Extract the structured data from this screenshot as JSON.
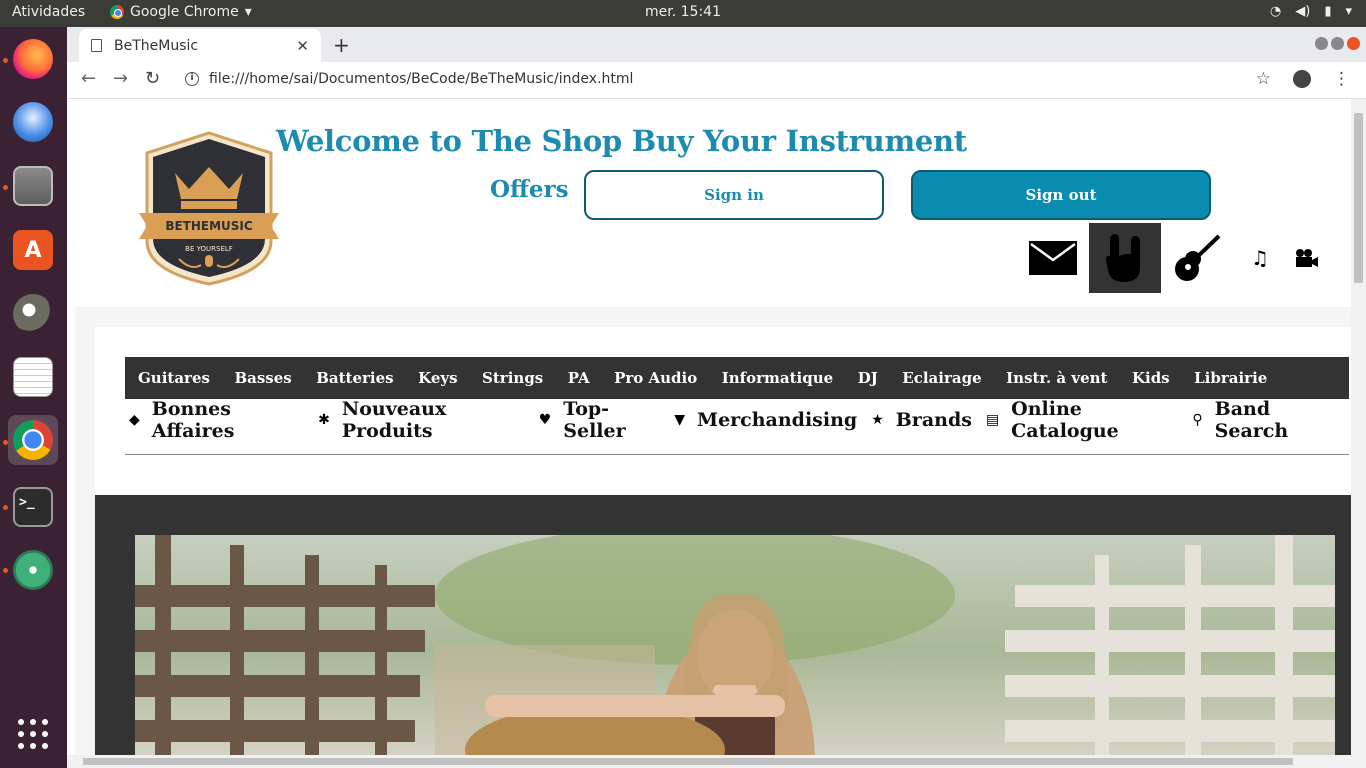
{
  "desktop": {
    "activities": "Atividades",
    "app_name": "Google Chrome",
    "clock": "mer. 15:41"
  },
  "browser": {
    "tab_title": "BeTheMusic",
    "url": "file:///home/sai/Documentos/BeCode/BeTheMusic/index.html"
  },
  "site": {
    "logo_text": "BETHEMUSIC",
    "logo_tagline": "BE YOURSELF",
    "welcome": "Welcome to The Shop Buy Your Instrument",
    "offers": "Offers",
    "sign_in": "Sign in",
    "sign_out": "Sign out",
    "categories": [
      "Guitares",
      "Basses",
      "Batteries",
      "Keys",
      "Strings",
      "PA",
      "Pro Audio",
      "Informatique",
      "DJ",
      "Eclairage",
      "Instr. à vent",
      "Kids",
      "Librairie"
    ],
    "subnav": [
      {
        "icon": "tag-icon",
        "label": "Bonnes Affaires"
      },
      {
        "icon": "asterisk-icon",
        "label": "Nouveaux Produits"
      },
      {
        "icon": "heart-icon",
        "label": "Top-Seller"
      },
      {
        "icon": "tshirt-icon",
        "label": "Merchandising"
      },
      {
        "icon": "star-icon",
        "label": "Brands"
      },
      {
        "icon": "book-icon",
        "label": "Online Catalogue"
      },
      {
        "icon": "search-icon",
        "label": "Band Search"
      }
    ]
  },
  "colors": {
    "brand": "#1b8cb0",
    "button_fill": "#0a8cb0",
    "dark_bar": "#333333",
    "ubuntu_orange": "#e95420"
  }
}
